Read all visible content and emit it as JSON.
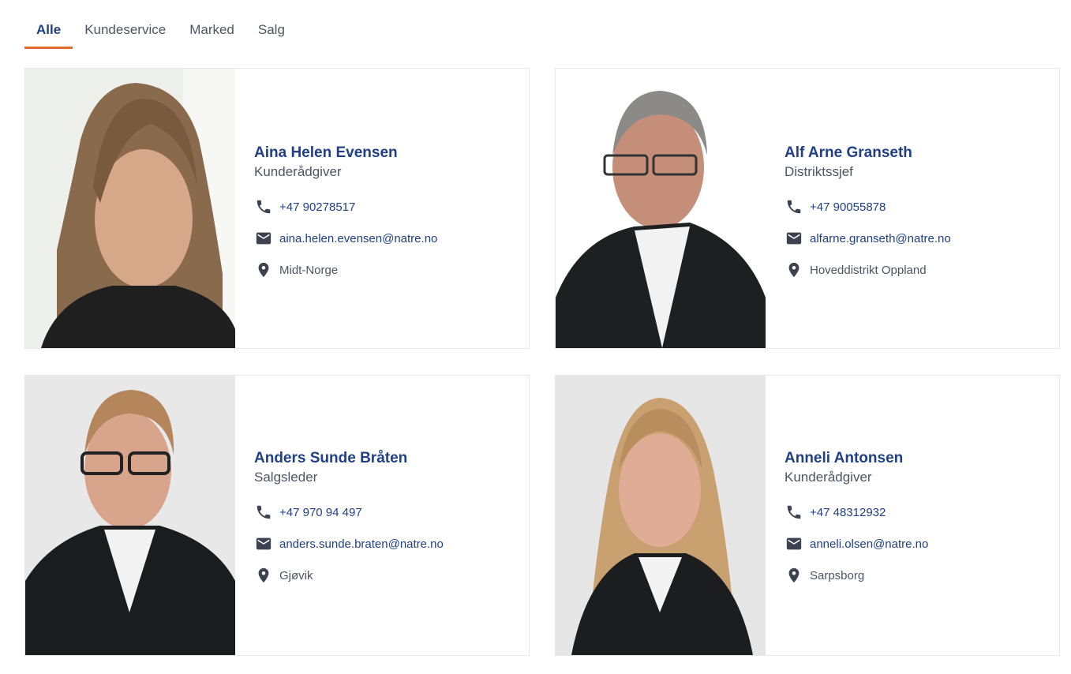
{
  "tabs": [
    {
      "label": "Alle",
      "active": true
    },
    {
      "label": "Kundeservice",
      "active": false
    },
    {
      "label": "Marked",
      "active": false
    },
    {
      "label": "Salg",
      "active": false
    }
  ],
  "employees": [
    {
      "name": "Aina Helen Evensen",
      "title": "Kunderådgiver",
      "phone": "+47 90278517",
      "email": "aina.helen.evensen@natre.no",
      "location": "Midt-Norge"
    },
    {
      "name": "Alf Arne Granseth",
      "title": "Distriktssjef",
      "phone": "+47 90055878",
      "email": "alfarne.granseth@natre.no",
      "location": "Hoveddistrikt Oppland"
    },
    {
      "name": "Anders Sunde Bråten",
      "title": "Salgsleder",
      "phone": "+47 970 94 497",
      "email": "anders.sunde.braten@natre.no",
      "location": "Gjøvik"
    },
    {
      "name": "Anneli Antonsen",
      "title": "Kunderådgiver",
      "phone": "+47 48312932",
      "email": "anneli.olsen@natre.no",
      "location": "Sarpsborg"
    }
  ],
  "colors": {
    "accent": "#e46a2c",
    "brand": "#1f3f86",
    "text": "#4b5563",
    "border": "#e5e7eb"
  },
  "icons": {
    "phone": "phone-icon",
    "email": "mail-icon",
    "location": "location-pin-icon"
  }
}
